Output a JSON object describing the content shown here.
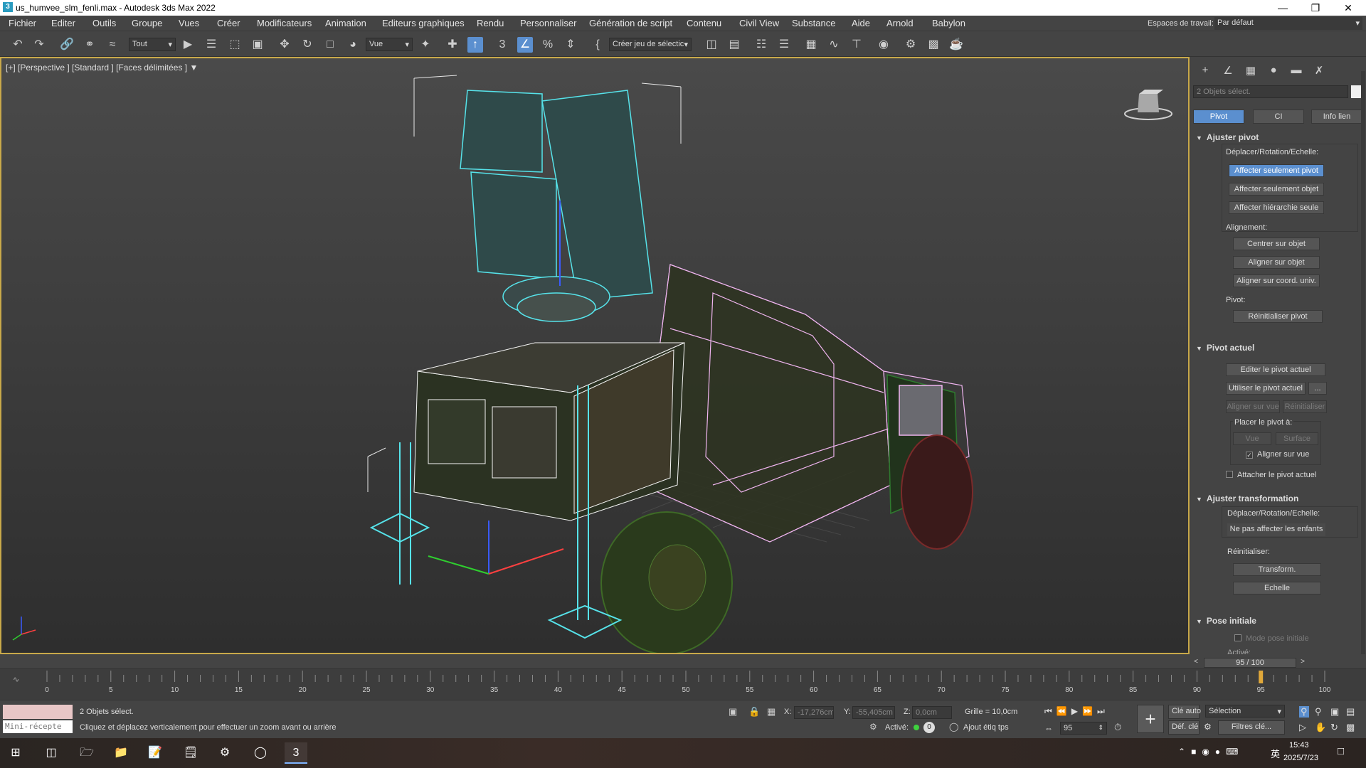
{
  "window": {
    "title": "us_humvee_slm_fenli.max - Autodesk 3ds Max 2022",
    "app_icon_letter": "3"
  },
  "menu": {
    "items": [
      "Fichier",
      "Editer",
      "Outils",
      "Groupe",
      "Vues",
      "Créer",
      "Modificateurs",
      "Animation",
      "Editeurs graphiques",
      "Rendu",
      "Personnaliser",
      "Génération de script",
      "Contenu",
      "Civil View",
      "Substance",
      "Aide",
      "Arnold",
      "Babylon"
    ],
    "workspace_label": "Espaces de travail:",
    "workspace_value": "Par défaut"
  },
  "toolbar": {
    "filter_value": "Tout",
    "ref_coord_value": "Vue",
    "selection_set_placeholder": "Créer jeu de sélectic"
  },
  "viewport": {
    "label": "[+] [Perspective ] [Standard ] [Faces délimitées ]"
  },
  "command_panel": {
    "selection_name": "2 Objets sélect.",
    "tabs": {
      "pivot": "Pivot",
      "ci": "CI",
      "link_info": "Info lien"
    },
    "adjust_pivot": {
      "title": "Ajuster pivot",
      "move_label": "Déplacer/Rotation/Echelle:",
      "btn_pivot_only": "Affecter seulement pivot",
      "btn_object_only": "Affecter seulement objet",
      "btn_hierarchy_only": "Affecter hiérarchie seule",
      "alignment_label": "Alignement:",
      "btn_center": "Centrer sur objet",
      "btn_align_object": "Aligner sur objet",
      "btn_align_world": "Aligner sur coord. univ.",
      "pivot_label": "Pivot:",
      "btn_reset_pivot": "Réinitialiser pivot"
    },
    "working_pivot": {
      "title": "Pivot actuel",
      "btn_edit": "Editer le pivot actuel",
      "btn_use": "Utiliser le pivot actuel",
      "btn_more": "...",
      "btn_align_view": "Aligner sur vue",
      "btn_reset": "Réinitialiser",
      "place_label": "Placer le pivot à:",
      "btn_view": "Vue",
      "btn_surface": "Surface",
      "align_view_check": "Aligner sur vue",
      "attach_check": "Attacher le pivot actuel"
    },
    "adjust_transform": {
      "title": "Ajuster transformation",
      "move_label": "Déplacer/Rotation/Echelle:",
      "btn_dont_affect": "Ne pas affecter les enfants",
      "reset_label": "Réinitialiser:",
      "btn_transform": "Transform.",
      "btn_scale": "Echelle"
    },
    "skin_pose": {
      "title": "Pose initiale",
      "mode_check": "Mode pose initiale",
      "cut_text": "Activé:"
    }
  },
  "timeline": {
    "frame_display": "95 / 100",
    "current_frame": 95,
    "total_frames": 100,
    "ticks": [
      "0",
      "5",
      "10",
      "15",
      "20",
      "25",
      "30",
      "35",
      "40",
      "45",
      "50",
      "55",
      "60",
      "65",
      "70",
      "75",
      "80",
      "85",
      "90",
      "95",
      "100"
    ]
  },
  "statusbar": {
    "selection": "2 Objets sélect.",
    "prompt": "Cliquez et déplacez verticalement pour effectuer un zoom avant ou arrière",
    "minilistener": "Mini-récepte",
    "x_label": "X:",
    "x_value": "-17,276cm",
    "y_label": "Y:",
    "y_value": "-55,405cm",
    "z_label": "Z:",
    "z_value": "0,0cm",
    "grid": "Grille = 10,0cm",
    "enabled_label": "Activé:",
    "enabled_value": "0",
    "add_time_tag": "Ajout étiq tps",
    "frame_spinner": "95",
    "auto_key": "Clé auto",
    "set_key": "Déf. clé",
    "selection_dropdown": "Sélection",
    "key_filters": "Filtres clé..."
  },
  "taskbar": {
    "time": "15:43",
    "date": "2025/7/23",
    "ime": "英"
  },
  "colors": {
    "accent": "#5b8fcf",
    "viewport_border": "#c9a94a",
    "wire_cyan": "#56e3ea",
    "wire_pink": "#f0b5f0"
  }
}
